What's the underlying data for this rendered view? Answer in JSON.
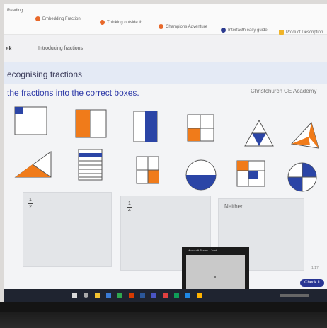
{
  "browser": {
    "bookmarks": [
      {
        "label": "Reading",
        "color": "#e8692b"
      },
      {
        "label": "Embedding Fraction",
        "color": "#e8692b"
      },
      {
        "label": "Thinking outside th",
        "color": "#e8692b"
      },
      {
        "label": "Champions Adventure",
        "color": "#e8692b"
      },
      {
        "label": "Interfacth easy guide",
        "color": "#2b3a8f"
      },
      {
        "label": "Product Description",
        "color": "#f0b429"
      }
    ]
  },
  "header": {
    "back_label": "ek",
    "lesson_label": "Introducing fractions"
  },
  "activity": {
    "title": "ecognising fractions",
    "instruction": "the fractions into the correct boxes.",
    "credit": "Christchurch CE Academy"
  },
  "drop_zones": [
    {
      "numerator": "1",
      "denominator": "2",
      "label": ""
    },
    {
      "numerator": "1",
      "denominator": "4",
      "label": ""
    },
    {
      "numerator": "",
      "denominator": "",
      "label": "Neither"
    }
  ],
  "popup": {
    "title": "Microsoft Teams - Joint"
  },
  "footer": {
    "check_label": "Check it",
    "page_label": "1/17"
  },
  "colors": {
    "orange": "#f07b1a",
    "blue": "#2b45a6",
    "accent": "#283593"
  }
}
